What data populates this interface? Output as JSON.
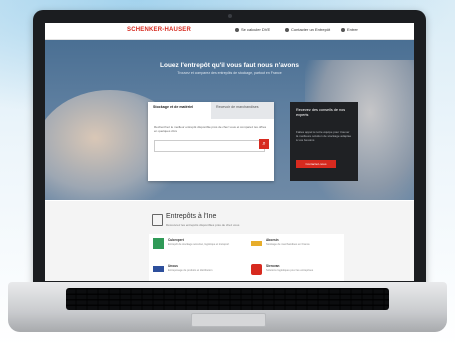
{
  "site": {
    "logo": "SCHENKER-HAUSER",
    "nav": [
      {
        "label": "Se calculer DVE",
        "icon": "phone-icon"
      },
      {
        "label": "Contacter un Entrepôt",
        "icon": "pin-icon"
      },
      {
        "label": "Entrer",
        "icon": "user-icon"
      }
    ]
  },
  "hero": {
    "title": "Louez l'entrepôt qu'il vous faut nous n'avons",
    "subtitle": "Trouvez et comparez des entrepôts de stockage, partout en France",
    "tabs": [
      {
        "label": "Stockage et de matériel",
        "state": "active"
      },
      {
        "label": "Recevoir de marchandises",
        "state": "inactive"
      }
    ],
    "card_text": "Recherchez le meilleur entrepôt disponible près de chez vous et comparez les offres en quelques clics",
    "search_placeholder": "",
    "promo": {
      "title": "Recevez des conseils de nos experts",
      "text": "Faites appel à notre équipe pour trouver la meilleure solution de stockage adaptée à vos besoins",
      "button": "Contactez-nous"
    }
  },
  "section": {
    "title": "Entrepôts à l'Ine",
    "subtitle": "Découvrez les entrepôts disponibles près de chez vous",
    "companies": [
      {
        "name": "Cubexpert",
        "desc": "Entrepôt de stockage sécurisé, logistique et transport",
        "color": "#2f9a57"
      },
      {
        "name": "Aboesin",
        "desc": "Stockage de marchandises en France",
        "color": "#e7ad2b"
      },
      {
        "name": "Unous",
        "desc": "Entreposage de produits et distribution",
        "color": "#2d4f9c"
      },
      {
        "name": "Sierovan",
        "desc": "Solutions logistiques pour les entreprises",
        "color": "#d72a1f"
      }
    ]
  }
}
